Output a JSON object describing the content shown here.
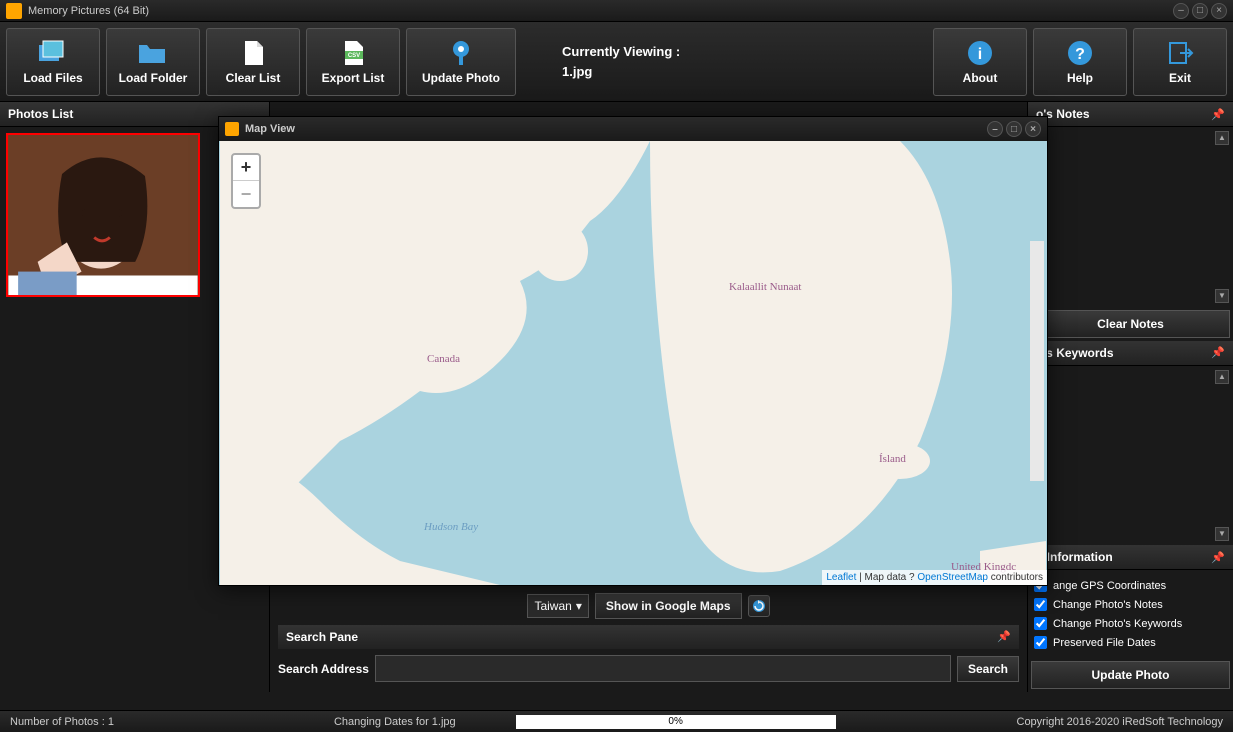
{
  "titlebar": {
    "title": "Memory Pictures  (64 Bit)"
  },
  "toolbar": {
    "load_files": "Load Files",
    "load_folder": "Load Folder",
    "clear_list": "Clear List",
    "export_list": "Export List",
    "update_photo": "Update Photo",
    "about": "About",
    "help": "Help",
    "exit": "Exit"
  },
  "viewing": {
    "label": "Currently Viewing :",
    "file": "1.jpg"
  },
  "panels": {
    "photos_list": "Photos List",
    "notes": "o's Notes",
    "clear_notes": "Clear Notes",
    "keywords": "o's Keywords",
    "geo_info": "g Information",
    "search_pane": "Search Pane",
    "search_addr": "Search Address",
    "search_btn": "Search"
  },
  "map": {
    "title": "Map View",
    "labels": {
      "canada": "Canada",
      "kalaallit": "Kalaallit Nunaat",
      "hudson": "Hudson Bay",
      "island": "Ísland",
      "uk": "United Kingdc"
    },
    "attr_leaflet": "Leaflet",
    "attr_mid": " | Map data ? ",
    "attr_osm": "OpenStreetMap",
    "attr_end": " contributors",
    "zoom_in": "+",
    "zoom_out": "−"
  },
  "country": {
    "value": "Taiwan",
    "show_maps": "Show in Google Maps"
  },
  "geo": {
    "gps": "ange GPS Coordinates",
    "notes": "Change Photo's Notes",
    "keywords": "Change Photo's Keywords",
    "dates": "Preserved File Dates",
    "update": "Update Photo"
  },
  "status": {
    "count": "Number of Photos : 1",
    "changing": "Changing Dates for 1.jpg",
    "progress": "0%",
    "copyright": "Copyright 2016-2020 iRedSoft Technology"
  }
}
